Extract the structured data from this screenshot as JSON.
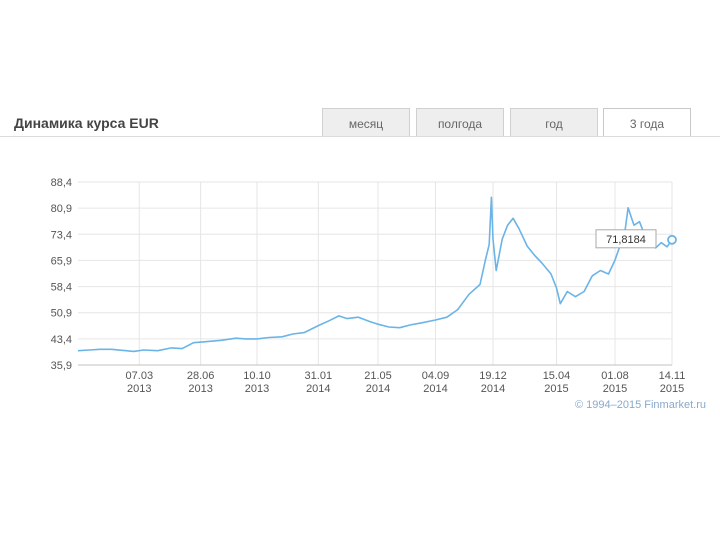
{
  "title": "Динамика курса EUR",
  "tabs": [
    {
      "label": "месяц",
      "active": false
    },
    {
      "label": "полгода",
      "active": false
    },
    {
      "label": "год",
      "active": false
    },
    {
      "label": "3 года",
      "active": true
    }
  ],
  "credit": "© 1994–2015 Finmarket.ru",
  "colors": {
    "line": "#6ab4e8",
    "accent": "#6ab4e8"
  },
  "chart_data": {
    "type": "line",
    "title": "Динамика курса EUR",
    "xlabel": "",
    "ylabel": "",
    "ylim": [
      35.9,
      88.4
    ],
    "y_ticks": [
      "35,9",
      "43,4",
      "50,9",
      "58,4",
      "65,9",
      "73,4",
      "80,9",
      "88,4"
    ],
    "x_range": [
      "2012-11-14",
      "2015-11-14"
    ],
    "x_ticks": [
      {
        "date": "2013-03-07",
        "line1": "07.03",
        "line2": "2013"
      },
      {
        "date": "2013-06-28",
        "line1": "28.06",
        "line2": "2013"
      },
      {
        "date": "2013-10-10",
        "line1": "10.10",
        "line2": "2013"
      },
      {
        "date": "2014-01-31",
        "line1": "31.01",
        "line2": "2014"
      },
      {
        "date": "2014-05-21",
        "line1": "21.05",
        "line2": "2014"
      },
      {
        "date": "2014-09-04",
        "line1": "04.09",
        "line2": "2014"
      },
      {
        "date": "2014-12-19",
        "line1": "19.12",
        "line2": "2014"
      },
      {
        "date": "2015-04-15",
        "line1": "15.04",
        "line2": "2015"
      },
      {
        "date": "2015-08-01",
        "line1": "01.08",
        "line2": "2015"
      },
      {
        "date": "2015-11-14",
        "line1": "14.11",
        "line2": "2015"
      }
    ],
    "grid": true,
    "series": [
      {
        "points": [
          [
            "2012-11-14",
            40.0
          ],
          [
            "2012-12-05",
            40.2
          ],
          [
            "2012-12-25",
            40.4
          ],
          [
            "2013-01-15",
            40.4
          ],
          [
            "2013-02-05",
            40.1
          ],
          [
            "2013-02-25",
            39.8
          ],
          [
            "2013-03-15",
            40.2
          ],
          [
            "2013-04-10",
            40.0
          ],
          [
            "2013-05-05",
            40.8
          ],
          [
            "2013-05-25",
            40.6
          ],
          [
            "2013-06-15",
            42.3
          ],
          [
            "2013-07-10",
            42.6
          ],
          [
            "2013-08-05",
            43.0
          ],
          [
            "2013-09-01",
            43.6
          ],
          [
            "2013-09-20",
            43.4
          ],
          [
            "2013-10-10",
            43.4
          ],
          [
            "2013-11-01",
            43.8
          ],
          [
            "2013-11-25",
            44.0
          ],
          [
            "2013-12-15",
            44.8
          ],
          [
            "2014-01-05",
            45.2
          ],
          [
            "2014-01-31",
            47.2
          ],
          [
            "2014-02-20",
            48.6
          ],
          [
            "2014-03-10",
            50.0
          ],
          [
            "2014-03-25",
            49.2
          ],
          [
            "2014-04-15",
            49.6
          ],
          [
            "2014-05-05",
            48.4
          ],
          [
            "2014-05-21",
            47.6
          ],
          [
            "2014-06-10",
            46.8
          ],
          [
            "2014-06-30",
            46.6
          ],
          [
            "2014-07-20",
            47.4
          ],
          [
            "2014-08-10",
            48.0
          ],
          [
            "2014-09-04",
            48.8
          ],
          [
            "2014-09-25",
            49.6
          ],
          [
            "2014-10-15",
            51.8
          ],
          [
            "2014-11-05",
            56.2
          ],
          [
            "2014-11-25",
            59.0
          ],
          [
            "2014-12-05",
            66.0
          ],
          [
            "2014-12-12",
            70.5
          ],
          [
            "2014-12-16",
            84.0
          ],
          [
            "2014-12-19",
            72.0
          ],
          [
            "2014-12-25",
            63.0
          ],
          [
            "2015-01-05",
            72.0
          ],
          [
            "2015-01-15",
            76.0
          ],
          [
            "2015-01-25",
            78.0
          ],
          [
            "2015-02-05",
            75.0
          ],
          [
            "2015-02-20",
            70.0
          ],
          [
            "2015-03-05",
            67.5
          ],
          [
            "2015-03-20",
            65.0
          ],
          [
            "2015-04-05",
            62.0
          ],
          [
            "2015-04-15",
            58.0
          ],
          [
            "2015-04-22",
            53.5
          ],
          [
            "2015-05-05",
            57.0
          ],
          [
            "2015-05-20",
            55.5
          ],
          [
            "2015-06-05",
            57.0
          ],
          [
            "2015-06-20",
            61.5
          ],
          [
            "2015-07-05",
            63.0
          ],
          [
            "2015-07-20",
            62.0
          ],
          [
            "2015-08-01",
            66.0
          ],
          [
            "2015-08-10",
            70.0
          ],
          [
            "2015-08-20",
            75.0
          ],
          [
            "2015-08-25",
            81.0
          ],
          [
            "2015-09-05",
            76.0
          ],
          [
            "2015-09-15",
            77.0
          ],
          [
            "2015-09-25",
            73.0
          ],
          [
            "2015-10-05",
            70.5
          ],
          [
            "2015-10-15",
            69.5
          ],
          [
            "2015-10-25",
            71.0
          ],
          [
            "2015-11-05",
            69.8
          ],
          [
            "2015-11-14",
            71.8184
          ]
        ]
      }
    ],
    "annotations": [
      {
        "date": "2015-11-14",
        "value": 71.8184,
        "text": "71,8184"
      }
    ]
  }
}
